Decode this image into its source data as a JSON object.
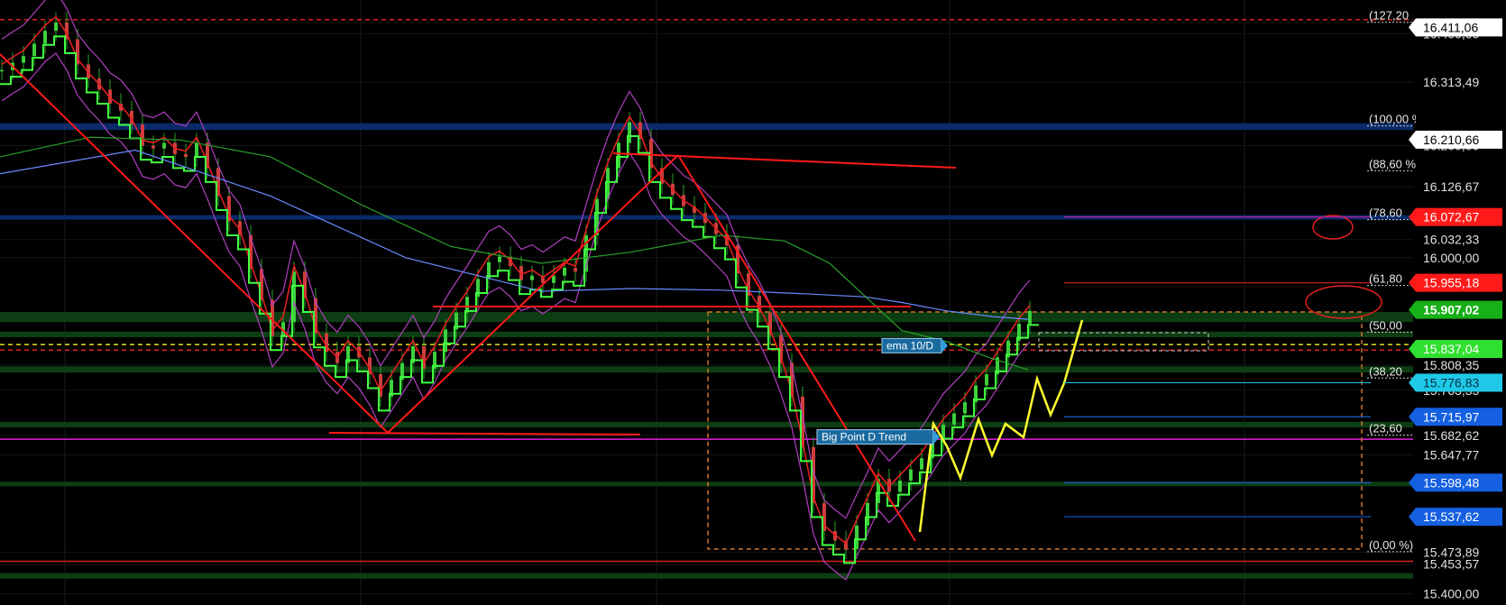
{
  "chart_data": {
    "type": "line",
    "title": "",
    "xlabel": "",
    "ylabel": "",
    "ylim": [
      15380,
      16460
    ],
    "grid": true,
    "price_axis": {
      "ticks": [
        {
          "value": 16400,
          "label": "16.400,00"
        },
        {
          "value": 16313.49,
          "label": "16.313,49"
        },
        {
          "value": 16200,
          "label": "16.200,00"
        },
        {
          "value": 16126.67,
          "label": "16.126,67"
        },
        {
          "value": 16032.33,
          "label": "16.032,33"
        },
        {
          "value": 16000,
          "label": "16.000,00"
        },
        {
          "value": 15808.35,
          "label": "15.808,35"
        },
        {
          "value": 15763.35,
          "label": "15.763,35"
        },
        {
          "value": 15682.62,
          "label": "15.682,62"
        },
        {
          "value": 15647.77,
          "label": "15.647,77"
        },
        {
          "value": 15473.89,
          "label": "15.473,89"
        },
        {
          "value": 15453.57,
          "label": "15.453,57"
        },
        {
          "value": 15400,
          "label": "15.400,00"
        }
      ]
    },
    "price_badges": [
      {
        "value": 16411.06,
        "label": "16.411,06",
        "style": "white"
      },
      {
        "value": 16210.66,
        "label": "16.210,66",
        "style": "white"
      },
      {
        "value": 16072.67,
        "label": "16.072,67",
        "style": "red"
      },
      {
        "value": 15955.18,
        "label": "15.955,18",
        "style": "red"
      },
      {
        "value": 15907.02,
        "label": "15.907,02",
        "style": "green"
      },
      {
        "value": 15837.04,
        "label": "15.837,04",
        "style": "bright-green"
      },
      {
        "value": 15776.83,
        "label": "15.776,83",
        "style": "cyan"
      },
      {
        "value": 15715.97,
        "label": "15.715,97",
        "style": "blue"
      },
      {
        "value": 15598.48,
        "label": "15.598,48",
        "style": "blue"
      },
      {
        "value": 15537.62,
        "label": "15.537,62",
        "style": "blue"
      }
    ],
    "fib_levels": [
      {
        "label": "(127,20",
        "value": 16425
      },
      {
        "label": "(100,00 %)",
        "value": 16240
      },
      {
        "label": "(88,60 %)",
        "value": 16160
      },
      {
        "label": "(78,60",
        "value": 16072.67
      },
      {
        "label": "(61,80",
        "value": 15955.18
      },
      {
        "label": "(50,00",
        "value": 15872
      },
      {
        "label": "(38,20",
        "value": 15790
      },
      {
        "label": "(23,60",
        "value": 15688
      },
      {
        "label": "(0,00 %)",
        "value": 15480
      }
    ],
    "horizontal_lines": [
      {
        "value": 16425,
        "color": "#e02020",
        "dash": true
      },
      {
        "value": 15845,
        "color": "#e8e020",
        "dash": true
      },
      {
        "value": 15835,
        "color": "#e02020",
        "dash": true
      },
      {
        "value": 15458,
        "color": "#e02020",
        "dash": false
      },
      {
        "value": 15676,
        "color": "#e020e0",
        "dash": false
      }
    ],
    "zones": [
      {
        "from": 16228,
        "to": 16240,
        "color": "#0a2a6a"
      },
      {
        "from": 16068,
        "to": 16076,
        "color": "#0a2a6a"
      },
      {
        "from": 15885,
        "to": 15903,
        "color": "#0d3d12"
      },
      {
        "from": 15858,
        "to": 15868,
        "color": "#0d3d12"
      },
      {
        "from": 15795,
        "to": 15806,
        "color": "#0d3d12"
      },
      {
        "from": 15697,
        "to": 15707,
        "color": "#0d3d12"
      },
      {
        "from": 15592,
        "to": 15600,
        "color": "#0d3d12"
      },
      {
        "from": 15427,
        "to": 15437,
        "color": "#0d3d12"
      }
    ],
    "annotations": [
      {
        "text": "ema 10/D",
        "value": 15843,
        "color": "#1a6aa0"
      },
      {
        "text": "Big Point D Trend",
        "value": 15680,
        "color": "#1a6aa0"
      }
    ],
    "series": [
      {
        "name": "",
        "color": "#7fe07f",
        "kind": "candles",
        "x": [
          0,
          12,
          24,
          36,
          48,
          60,
          72,
          84,
          96,
          108,
          120,
          132,
          144,
          156,
          168,
          180,
          192,
          204,
          216,
          228,
          240,
          252,
          264,
          276,
          288,
          300,
          312,
          324,
          336,
          348,
          360,
          372,
          384,
          396,
          408,
          420,
          432,
          444,
          456,
          468,
          480,
          492,
          504,
          516,
          528,
          540,
          552,
          564,
          576,
          588,
          600,
          612,
          624,
          636,
          648,
          660,
          672,
          684,
          696,
          708,
          720,
          732,
          744,
          756,
          768,
          780,
          792,
          804,
          816,
          828,
          840,
          852,
          864,
          876,
          888,
          900,
          912,
          924,
          936,
          948,
          960,
          972,
          984,
          996,
          1008,
          1020,
          1032,
          1044,
          1056,
          1068,
          1080,
          1092,
          1104,
          1116,
          1128,
          1140
        ],
        "values": [
          16335,
          16348,
          16360,
          16382,
          16405,
          16420,
          16390,
          16345,
          16320,
          16300,
          16275,
          16262,
          16238,
          16200,
          16195,
          16205,
          16185,
          16180,
          16205,
          16160,
          16110,
          16065,
          16040,
          15980,
          15925,
          15860,
          15885,
          15975,
          15928,
          15865,
          15832,
          15812,
          15842,
          15822,
          15792,
          15752,
          15782,
          15812,
          15842,
          15802,
          15832,
          15872,
          15902,
          15930,
          15962,
          15992,
          16002,
          15985,
          15960,
          15968,
          15955,
          15968,
          15982,
          15975,
          16040,
          16105,
          16160,
          16205,
          16242,
          16212,
          16160,
          16132,
          16112,
          16092,
          16080,
          16062,
          16042,
          16022,
          15972,
          15932,
          15902,
          15862,
          15812,
          15752,
          15662,
          15562,
          15512,
          15495,
          15480,
          15522,
          15562,
          15605,
          15582,
          15602,
          15622,
          15642,
          15672,
          15702,
          15722,
          15742,
          15772,
          15792,
          15822,
          15852,
          15882,
          15905
        ]
      },
      {
        "name": "",
        "color": "#6a8aff",
        "kind": "line",
        "x": [
          0,
          150,
          300,
          450,
          600,
          700,
          800,
          900,
          960,
          1000,
          1050,
          1100,
          1140
        ],
        "values": [
          16150,
          16192,
          16110,
          16000,
          15940,
          15945,
          15942,
          15935,
          15930,
          15920,
          15905,
          15895,
          15890
        ]
      },
      {
        "name": "",
        "color": "#2aa02a",
        "kind": "line",
        "x": [
          0,
          100,
          200,
          300,
          400,
          500,
          600,
          700,
          800,
          870,
          920,
          960,
          1000,
          1050,
          1100,
          1140
        ],
        "values": [
          16180,
          16215,
          16210,
          16180,
          16095,
          16020,
          15990,
          16010,
          16040,
          16030,
          15990,
          15930,
          15870,
          15850,
          15820,
          15800
        ]
      }
    ]
  }
}
